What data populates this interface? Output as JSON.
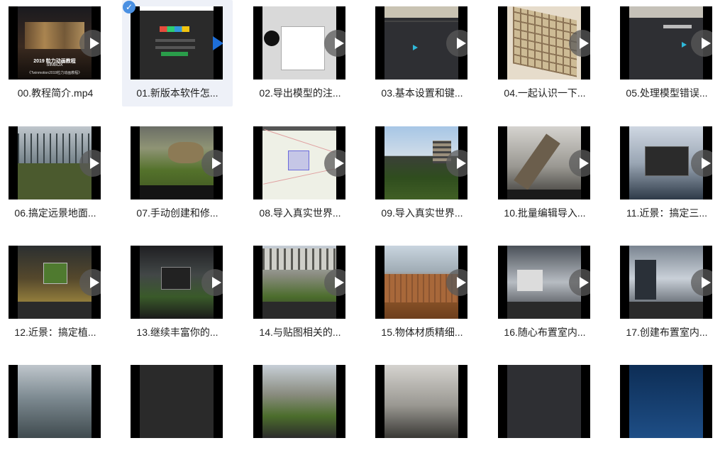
{
  "items": [
    {
      "label": "00.教程简介.mp4",
      "thumb_title": "2019 粒力动画教程",
      "thumb_sub1": "SIMBOX",
      "thumb_sub2": "《Twinmotion2019粒力动画教程》"
    },
    {
      "label": "01.新版本软件怎..."
    },
    {
      "label": "02.导出模型的注..."
    },
    {
      "label": "03.基本设置和键..."
    },
    {
      "label": "04.一起认识一下..."
    },
    {
      "label": "05.处理模型错误..."
    },
    {
      "label": "06.搞定远景地面..."
    },
    {
      "label": "07.手动创建和修..."
    },
    {
      "label": "08.导入真实世界..."
    },
    {
      "label": "09.导入真实世界..."
    },
    {
      "label": "10.批量编辑导入..."
    },
    {
      "label": "11.近景：搞定三..."
    },
    {
      "label": "12.近景：搞定植..."
    },
    {
      "label": "13.继续丰富你的..."
    },
    {
      "label": "14.与贴图相关的..."
    },
    {
      "label": "15.物体材质精细..."
    },
    {
      "label": "16.随心布置室内..."
    },
    {
      "label": "17.创建布置室内..."
    },
    {
      "label": ""
    },
    {
      "label": ""
    },
    {
      "label": ""
    },
    {
      "label": ""
    },
    {
      "label": ""
    },
    {
      "label": ""
    }
  ],
  "icons": {
    "play": "play-icon",
    "check": "check-icon"
  },
  "colors": {
    "selected_bg": "#eef1f8",
    "check_blue": "#4a90e2",
    "play_blue": "#1e6fd9"
  }
}
